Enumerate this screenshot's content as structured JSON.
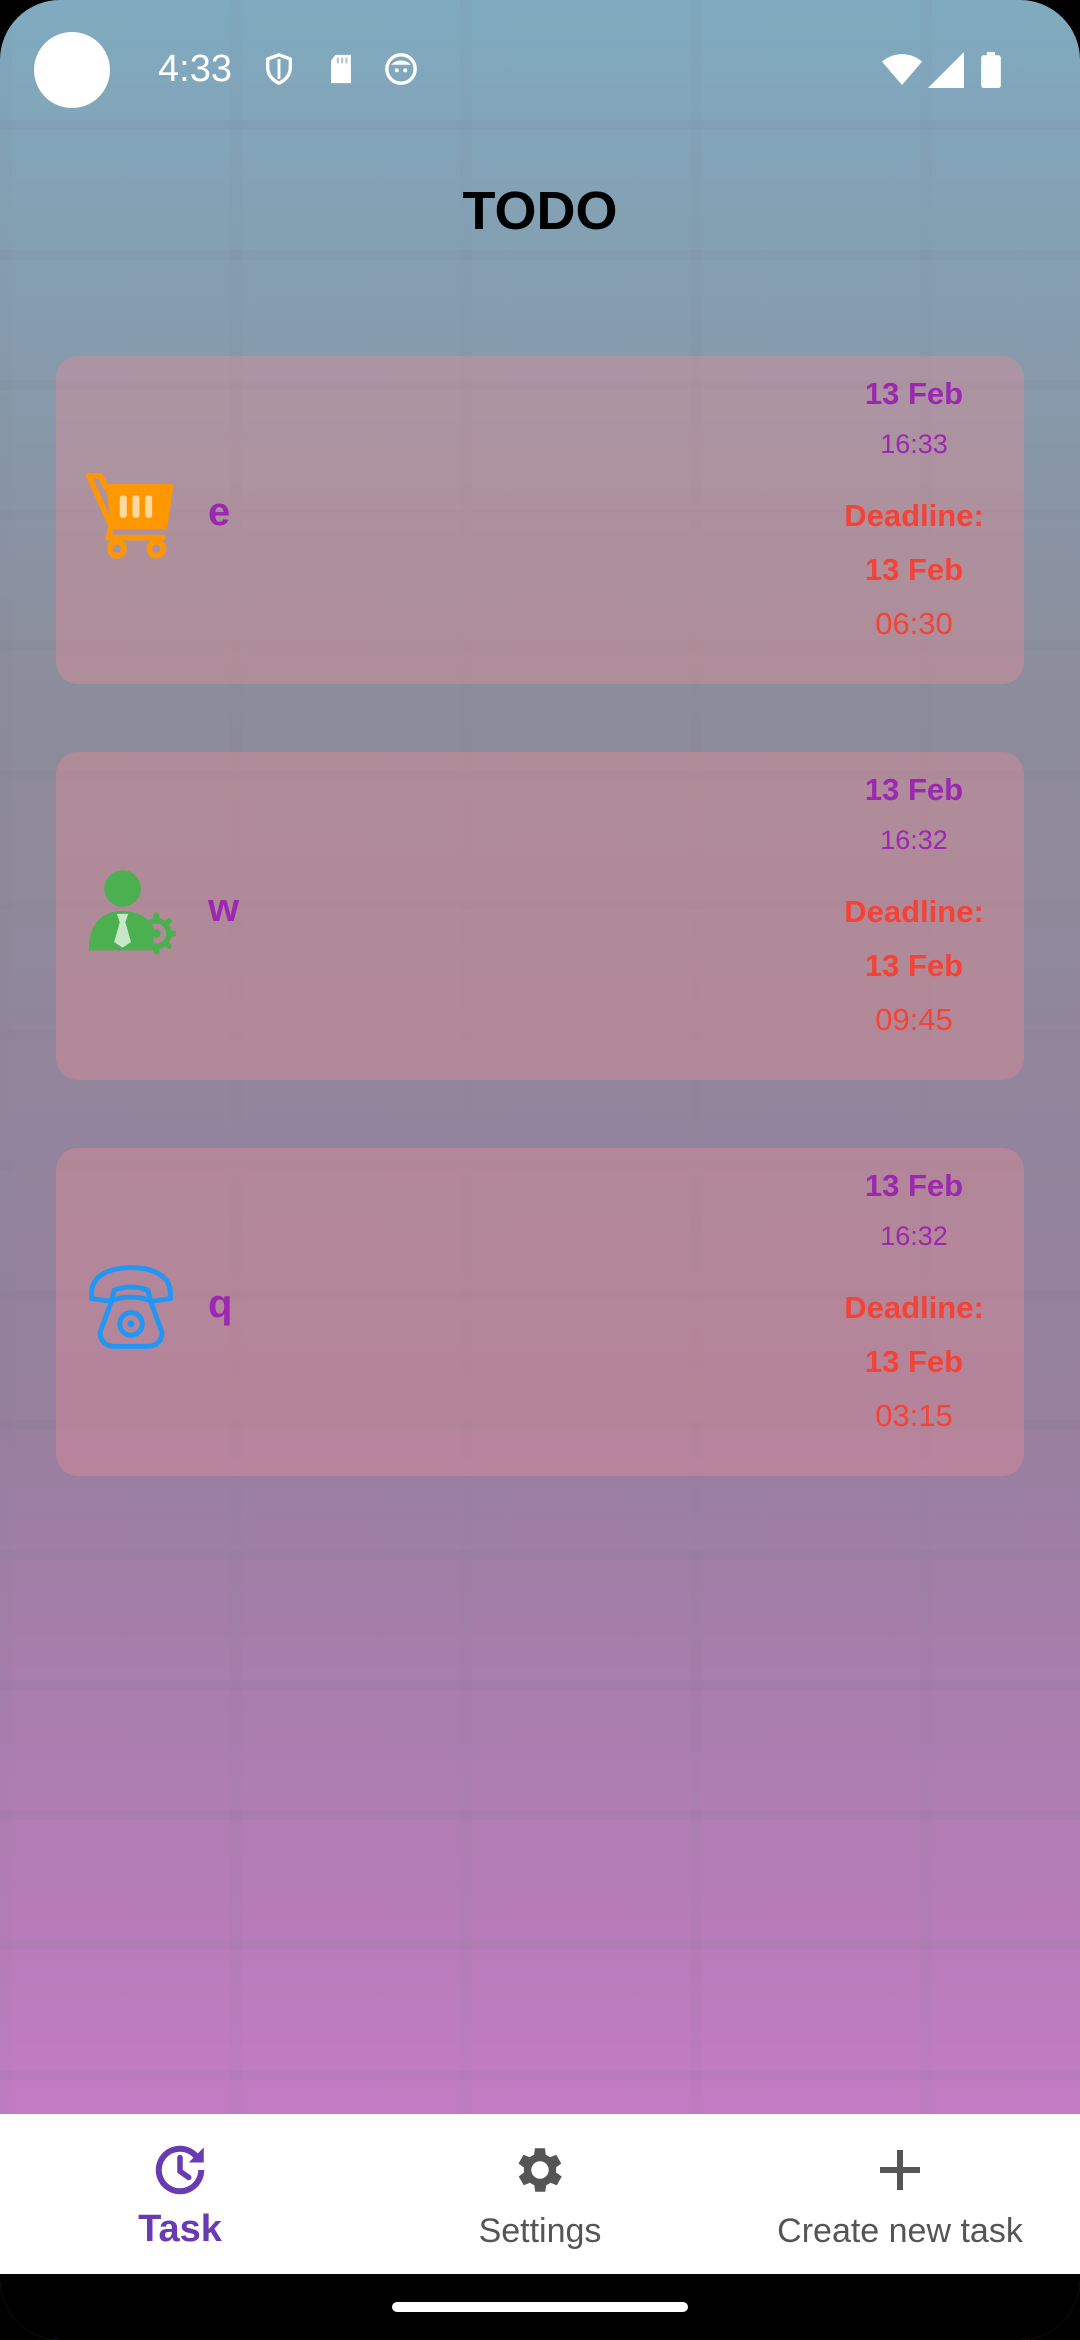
{
  "status_bar": {
    "time": "4:33",
    "icons": [
      "shield-icon",
      "sd-card-icon",
      "face-icon",
      "wifi-icon",
      "cell-signal-icon",
      "battery-icon"
    ]
  },
  "app": {
    "title": "TODO"
  },
  "tasks": [
    {
      "icon": "shopping-cart-icon",
      "icon_color": "#ff9800",
      "title": "e",
      "created_date": "13 Feb",
      "created_time": "16:33",
      "deadline_label": "Deadline:",
      "deadline_date": "13 Feb",
      "deadline_time": "06:30"
    },
    {
      "icon": "business-person-gear-icon",
      "icon_color": "#4caf50",
      "title": "w",
      "created_date": "13 Feb",
      "created_time": "16:32",
      "deadline_label": "Deadline:",
      "deadline_date": "13 Feb",
      "deadline_time": "09:45"
    },
    {
      "icon": "telephone-icon",
      "icon_color": "#2196f3",
      "title": "q",
      "created_date": "13 Feb",
      "created_time": "16:32",
      "deadline_label": "Deadline:",
      "deadline_date": "13 Feb",
      "deadline_time": "03:15"
    }
  ],
  "bottom_nav": {
    "items": [
      {
        "label": "Task",
        "icon": "history-clock-icon",
        "active": true
      },
      {
        "label": "Settings",
        "icon": "gear-icon",
        "active": false
      },
      {
        "label": "Create new task",
        "icon": "plus-icon",
        "active": false
      }
    ]
  },
  "colors": {
    "accent": "#6a3ab3",
    "task_title": "#9c27b0",
    "deadline": "#f44336"
  }
}
